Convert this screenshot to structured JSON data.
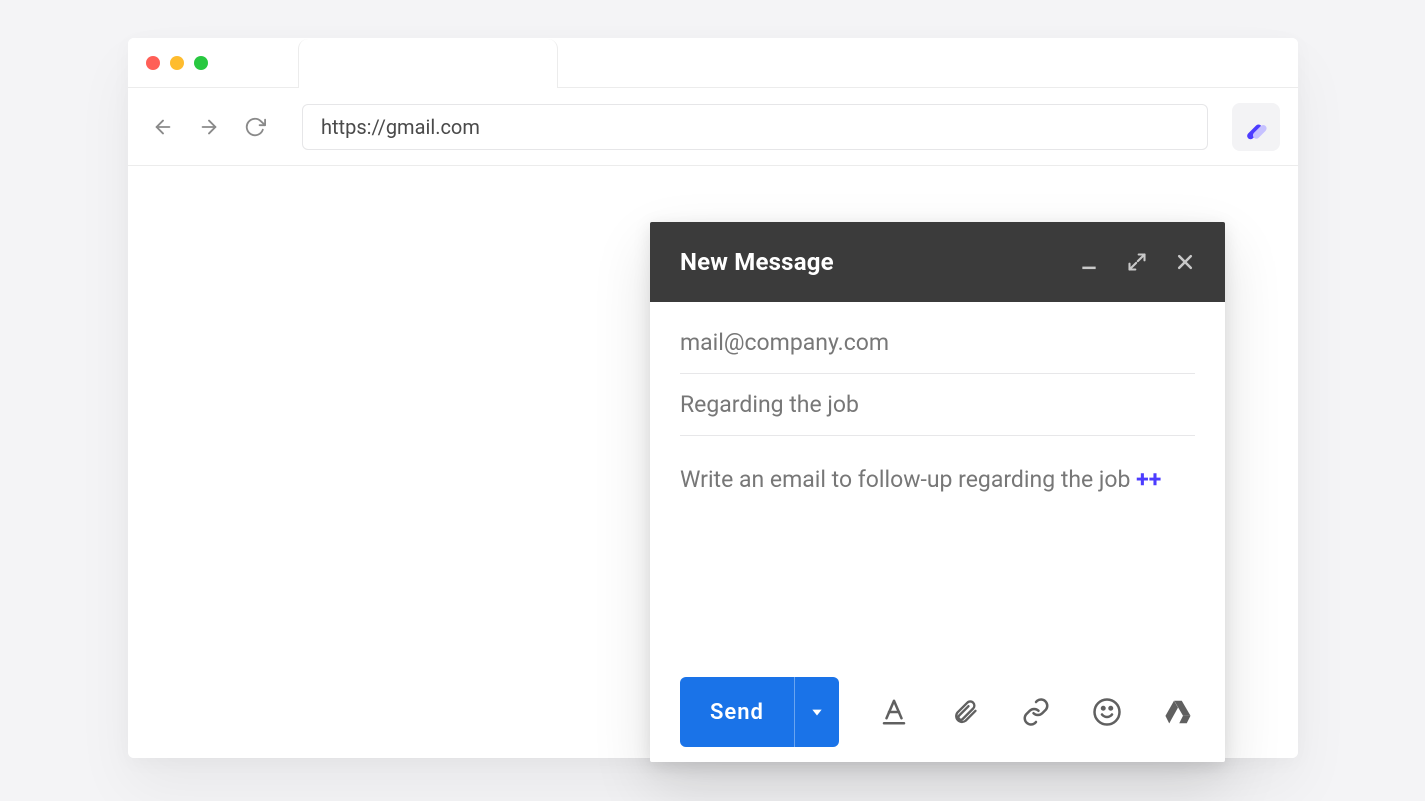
{
  "browser": {
    "url": "https://gmail.com"
  },
  "compose": {
    "title": "New Message",
    "to": "mail@company.com",
    "subject": "Regarding the job",
    "body_text": "Write an email to follow-up regarding the job ",
    "body_suffix": "++",
    "send_label": "Send"
  }
}
